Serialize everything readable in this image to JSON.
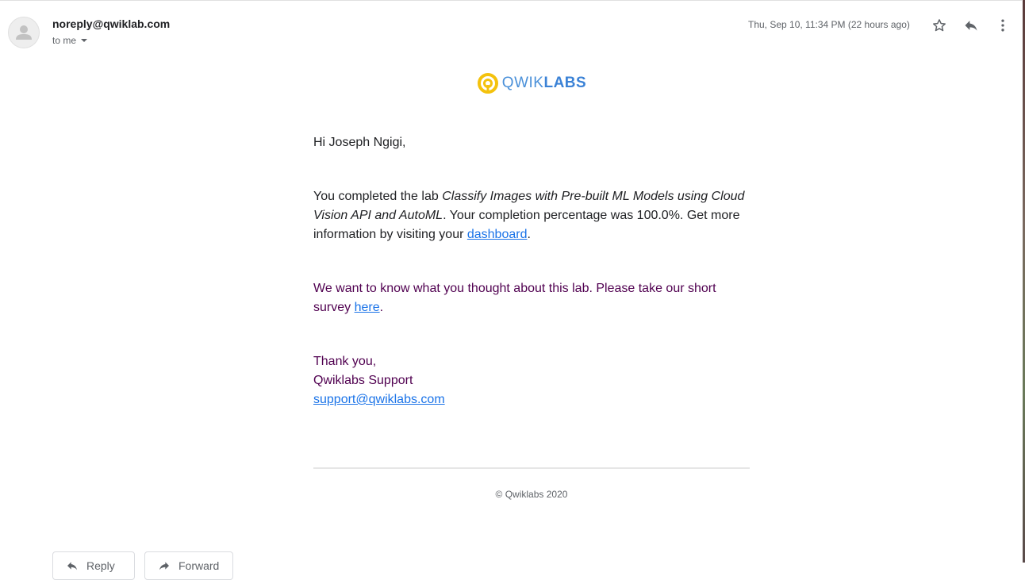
{
  "header": {
    "sender": "noreply@qwiklab.com",
    "recipient": "to me",
    "datetime": "Thu, Sep 10, 11:34 PM (22 hours ago)"
  },
  "icons": {
    "avatar": "person-icon",
    "star": "star-icon",
    "reply": "reply-icon",
    "more": "more-vert-icon",
    "logo": "qwiklabs-logo-icon"
  },
  "logo": {
    "part1": "QWIK",
    "part2": "LABS"
  },
  "body": {
    "greeting": "Hi Joseph Ngigi,",
    "p1_prefix": "You completed the lab ",
    "p1_lab": "Classify Images with Pre-built ML Models using Cloud Vision API and AutoML",
    "p1_middle": ". Your completion percentage was 100.0%. Get more information by visiting your ",
    "p1_link": "dashboard",
    "p1_suffix": ".",
    "p2_prefix": "We want to know what you thought about this lab. Please take our short survey ",
    "p2_link": "here",
    "p2_suffix": ".",
    "sign_thanks": "Thank you,",
    "sign_name": "Qwiklabs Support",
    "sign_email": "support@qwiklabs.com"
  },
  "footer": {
    "copyright": "© Qwiklabs 2020"
  },
  "actions": {
    "reply": "Reply",
    "forward": "Forward"
  },
  "colors": {
    "link": "#1a73e8",
    "quoted_text": "#500050",
    "logo_yellow": "#f4c20d",
    "logo_blue": "#4a90d9"
  }
}
